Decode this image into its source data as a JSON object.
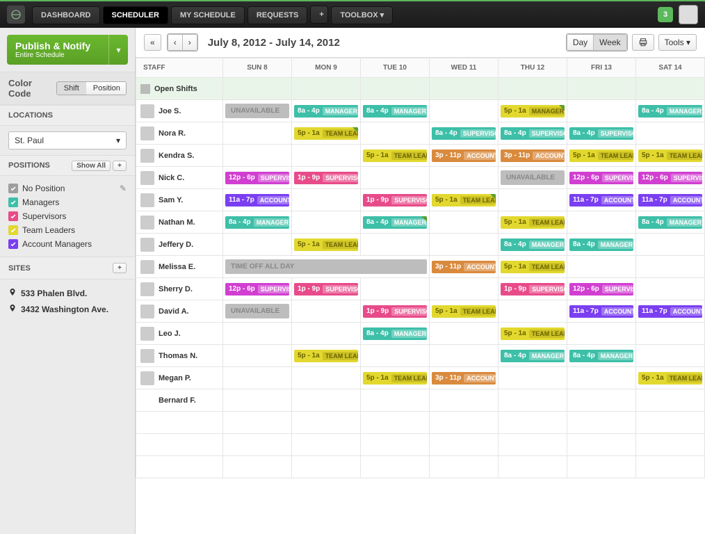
{
  "nav": {
    "items": [
      "DASHBOARD",
      "SCHEDULER",
      "MY SCHEDULE",
      "REQUESTS",
      "TOOLBOX ▾"
    ],
    "activeIndex": 1,
    "notifCount": "3"
  },
  "publish": {
    "title": "Publish & Notify",
    "sub": "Entire Schedule"
  },
  "colorcode": {
    "label": "Color Code",
    "options": [
      "Shift",
      "Position"
    ],
    "active": 0
  },
  "locations": {
    "title": "LOCATIONS",
    "value": "St. Paul"
  },
  "positions": {
    "title": "POSITIONS",
    "showAll": "Show All",
    "items": [
      {
        "label": "No Position",
        "color": "#9e9e9e"
      },
      {
        "label": "Managers",
        "color": "#3dbfa8"
      },
      {
        "label": "Supervisors",
        "color": "#e84b8a"
      },
      {
        "label": "Team Leaders",
        "color": "#e2d82f"
      },
      {
        "label": "Account Managers",
        "color": "#7b3ff2"
      }
    ]
  },
  "sites": {
    "title": "SITES",
    "items": [
      "533 Phalen Blvd.",
      "3432 Washington Ave."
    ]
  },
  "toolbar": {
    "dateRange": "July 8, 2012 - July 14, 2012",
    "day": "Day",
    "week": "Week",
    "tools": "Tools ▾"
  },
  "days": [
    "SUN 8",
    "MON 9",
    "TUE 10",
    "WED 11",
    "THU 12",
    "FRI 13",
    "SAT 14"
  ],
  "staffHeader": "STAFF",
  "openShiftsLabel": "Open Shifts",
  "staff": [
    {
      "name": "Joe S.",
      "cells": [
        {
          "t": "unavail",
          "label": "UNAVAILABLE"
        },
        {
          "t": "shift",
          "time": "8a - 4p",
          "tag": "MANAGER",
          "c": "teal"
        },
        {
          "t": "shift",
          "time": "8a - 4p",
          "tag": "MANAGER",
          "c": "teal"
        },
        null,
        {
          "t": "shift",
          "time": "5p - 1a",
          "tag": "MANAGER",
          "c": "yellow",
          "flag": true
        },
        null,
        {
          "t": "shift",
          "time": "8a - 4p",
          "tag": "MANAGER",
          "c": "teal"
        }
      ]
    },
    {
      "name": "Nora R.",
      "cells": [
        null,
        {
          "t": "shift",
          "time": "5p - 1a",
          "tag": "TEAM LEADE",
          "c": "yellow",
          "flag": true
        },
        null,
        {
          "t": "shift",
          "time": "8a - 4p",
          "tag": "SUPERVISOR",
          "c": "teal"
        },
        {
          "t": "shift",
          "time": "8a - 4p",
          "tag": "SUPERVISOR",
          "c": "teal"
        },
        {
          "t": "shift",
          "time": "8a - 4p",
          "tag": "SUPERVISOR",
          "c": "teal"
        },
        null
      ]
    },
    {
      "name": "Kendra S.",
      "cells": [
        null,
        null,
        {
          "t": "shift",
          "time": "5p - 1a",
          "tag": "TEAM LEADE",
          "c": "yellow"
        },
        {
          "t": "shift",
          "time": "3p - 11p",
          "tag": "ACCOUNT M",
          "c": "orange"
        },
        {
          "t": "shift",
          "time": "3p - 11p",
          "tag": "ACCOUNT M",
          "c": "orange"
        },
        {
          "t": "shift",
          "time": "5p - 1a",
          "tag": "TEAM LEADE",
          "c": "yellow"
        },
        {
          "t": "shift",
          "time": "5p - 1a",
          "tag": "TEAM LEADE",
          "c": "yellow"
        }
      ]
    },
    {
      "name": "Nick C.",
      "cells": [
        {
          "t": "shift",
          "time": "12p - 6p",
          "tag": "SUPERVISO",
          "c": "magenta"
        },
        {
          "t": "shift",
          "time": "1p - 9p",
          "tag": "SUPERVISO",
          "c": "pink"
        },
        null,
        null,
        {
          "t": "unavail",
          "label": "UNAVAILABLE"
        },
        {
          "t": "shift",
          "time": "12p - 6p",
          "tag": "SUPERVISO",
          "c": "magenta"
        },
        {
          "t": "shift",
          "time": "12p - 6p",
          "tag": "SUPERVISO",
          "c": "magenta"
        }
      ]
    },
    {
      "name": "Sam Y.",
      "cells": [
        {
          "t": "shift",
          "time": "11a - 7p",
          "tag": "ACCOUNT M",
          "c": "purple"
        },
        null,
        {
          "t": "shift",
          "time": "1p - 9p",
          "tag": "SUPERVISO",
          "c": "pink"
        },
        {
          "t": "shift",
          "time": "5p - 1a",
          "tag": "TEAM LEADE",
          "c": "yellow",
          "flag": true
        },
        null,
        {
          "t": "shift",
          "time": "11a - 7p",
          "tag": "ACCOUNT M",
          "c": "purple"
        },
        {
          "t": "shift",
          "time": "11a - 7p",
          "tag": "ACCOUNT M",
          "c": "purple"
        }
      ]
    },
    {
      "name": "Nathan M.",
      "cells": [
        {
          "t": "shift",
          "time": "8a - 4p",
          "tag": "MANAGER",
          "c": "teal"
        },
        null,
        {
          "t": "shift",
          "time": "8a - 4p",
          "tag": "MANAGER",
          "c": "teal",
          "flag": true
        },
        null,
        {
          "t": "shift",
          "time": "5p - 1a",
          "tag": "TEAM LEADE",
          "c": "yellow"
        },
        null,
        {
          "t": "shift",
          "time": "8a - 4p",
          "tag": "MANAGER",
          "c": "teal"
        }
      ]
    },
    {
      "name": "Jeffery D.",
      "cells": [
        null,
        {
          "t": "shift",
          "time": "5p - 1a",
          "tag": "TEAM LEADE",
          "c": "yellow"
        },
        null,
        null,
        {
          "t": "shift",
          "time": "8a - 4p",
          "tag": "MANAGER",
          "c": "teal"
        },
        {
          "t": "shift",
          "time": "8a - 4p",
          "tag": "MANAGER",
          "c": "teal"
        },
        null
      ]
    },
    {
      "name": "Melissa E.",
      "cells": [
        {
          "t": "timeoff",
          "label": "TIME OFF ALL DAY",
          "span": 3
        },
        null,
        null,
        {
          "t": "shift",
          "time": "3p - 11p",
          "tag": "ACCOUNT M",
          "c": "orange"
        },
        {
          "t": "shift",
          "time": "5p - 1a",
          "tag": "TEAM LEADE",
          "c": "yellow"
        },
        null,
        null
      ]
    },
    {
      "name": "Sherry D.",
      "cells": [
        {
          "t": "shift",
          "time": "12p - 6p",
          "tag": "SUPERVISO",
          "c": "magenta"
        },
        {
          "t": "shift",
          "time": "1p - 9p",
          "tag": "SUPERVISO",
          "c": "pink"
        },
        null,
        null,
        {
          "t": "shift",
          "time": "1p - 9p",
          "tag": "SUPERVISO",
          "c": "pink"
        },
        {
          "t": "shift",
          "time": "12p - 6p",
          "tag": "SUPERVISO",
          "c": "magenta"
        },
        null
      ]
    },
    {
      "name": "David A.",
      "cells": [
        {
          "t": "unavail",
          "label": "UNAVAILABLE"
        },
        null,
        {
          "t": "shift",
          "time": "1p - 9p",
          "tag": "SUPERVISO",
          "c": "pink"
        },
        {
          "t": "shift",
          "time": "5p - 1a",
          "tag": "TEAM LEADE",
          "c": "yellow"
        },
        null,
        {
          "t": "shift",
          "time": "11a - 7p",
          "tag": "ACCOUNT M",
          "c": "purple"
        },
        {
          "t": "shift",
          "time": "11a - 7p",
          "tag": "ACCOUNT M",
          "c": "purple"
        }
      ]
    },
    {
      "name": "Leo J.",
      "cells": [
        null,
        null,
        {
          "t": "shift",
          "time": "8a - 4p",
          "tag": "MANAGER",
          "c": "teal"
        },
        null,
        {
          "t": "shift",
          "time": "5p - 1a",
          "tag": "TEAM LEADE",
          "c": "yellow"
        },
        null,
        null
      ]
    },
    {
      "name": "Thomas N.",
      "cells": [
        null,
        {
          "t": "shift",
          "time": "5p - 1a",
          "tag": "TEAM LEADE",
          "c": "yellow"
        },
        null,
        null,
        {
          "t": "shift",
          "time": "8a - 4p",
          "tag": "MANAGER",
          "c": "teal"
        },
        {
          "t": "shift",
          "time": "8a - 4p",
          "tag": "MANAGER",
          "c": "teal"
        },
        null
      ]
    },
    {
      "name": "Megan P.",
      "cells": [
        null,
        null,
        {
          "t": "shift",
          "time": "5p - 1a",
          "tag": "TEAM LEADE",
          "c": "yellow"
        },
        {
          "t": "shift",
          "time": "3p - 11p",
          "tag": "ACCOUNT M",
          "c": "orange"
        },
        null,
        null,
        {
          "t": "shift",
          "time": "5p - 1a",
          "tag": "TEAM LEADE",
          "c": "yellow"
        }
      ]
    },
    {
      "name": "Bernard F.",
      "noAvatar": true,
      "cells": [
        null,
        null,
        null,
        null,
        null,
        null,
        null
      ]
    }
  ],
  "emptyRows": 3
}
